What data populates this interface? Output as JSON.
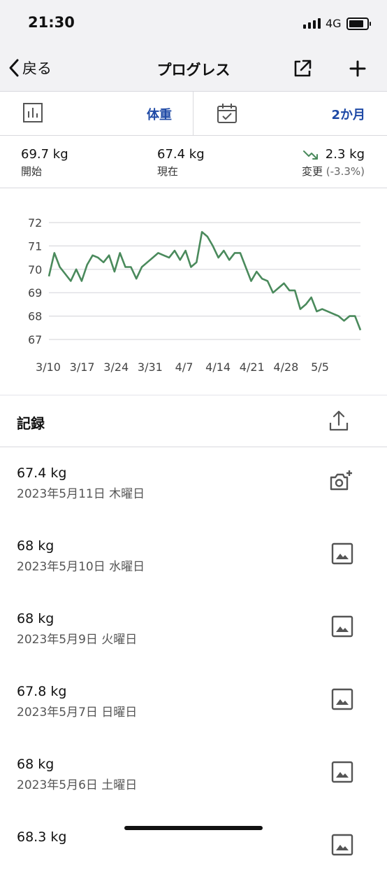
{
  "status_bar": {
    "time": "21:30",
    "network": "4G"
  },
  "nav": {
    "back_label": "戻る",
    "title": "プログレス"
  },
  "selector": {
    "metric": "体重",
    "range": "2か月"
  },
  "stats": [
    {
      "value": "69.7 kg",
      "label": "開始"
    },
    {
      "value": "67.4 kg",
      "label": "現在"
    }
  ],
  "change": {
    "value": "2.3 kg",
    "label": "変更",
    "percent": "(-3.3%)",
    "arrow_color": "#4a8a5c"
  },
  "chart_data": {
    "type": "line",
    "color": "#4a8a5c",
    "ylim": [
      67,
      72
    ],
    "yticks": [
      "72",
      "71",
      "70",
      "69",
      "68",
      "67"
    ],
    "xticks": [
      "3/10",
      "3/17",
      "3/24",
      "3/31",
      "4/7",
      "4/14",
      "4/21",
      "4/28",
      "5/5"
    ],
    "series": [
      {
        "values": [
          69.7,
          70.7,
          70.1,
          69.8,
          69.5,
          70.0,
          69.5,
          70.2,
          70.6,
          70.5,
          70.3,
          70.6,
          69.9,
          70.7,
          70.1,
          70.1,
          69.6,
          70.1,
          70.3,
          70.5,
          70.7,
          70.6,
          70.5,
          70.8,
          70.4,
          70.8,
          70.1,
          70.3,
          71.6,
          71.4,
          71.0,
          70.5,
          70.8,
          70.4,
          70.7,
          70.7,
          70.1,
          69.5,
          69.9,
          69.6,
          69.5,
          69.0,
          69.2,
          69.4,
          69.1,
          69.1,
          68.3,
          68.5,
          68.8,
          68.2,
          68.3,
          68.2,
          68.1,
          68.0,
          67.8,
          68.0,
          68.0,
          67.4
        ]
      }
    ]
  },
  "records": {
    "title": "記録",
    "items": [
      {
        "weight": "67.4 kg",
        "date": "2023年5月11日 木曜日",
        "icon": "add-photo-icon"
      },
      {
        "weight": "68 kg",
        "date": "2023年5月10日 水曜日",
        "icon": "image-icon"
      },
      {
        "weight": "68 kg",
        "date": "2023年5月9日 火曜日",
        "icon": "image-icon"
      },
      {
        "weight": "67.8 kg",
        "date": "2023年5月7日 日曜日",
        "icon": "image-icon"
      },
      {
        "weight": "68 kg",
        "date": "2023年5月6日 土曜日",
        "icon": "image-icon"
      },
      {
        "weight": "68.3 kg",
        "date": "",
        "icon": "image-icon"
      }
    ]
  }
}
